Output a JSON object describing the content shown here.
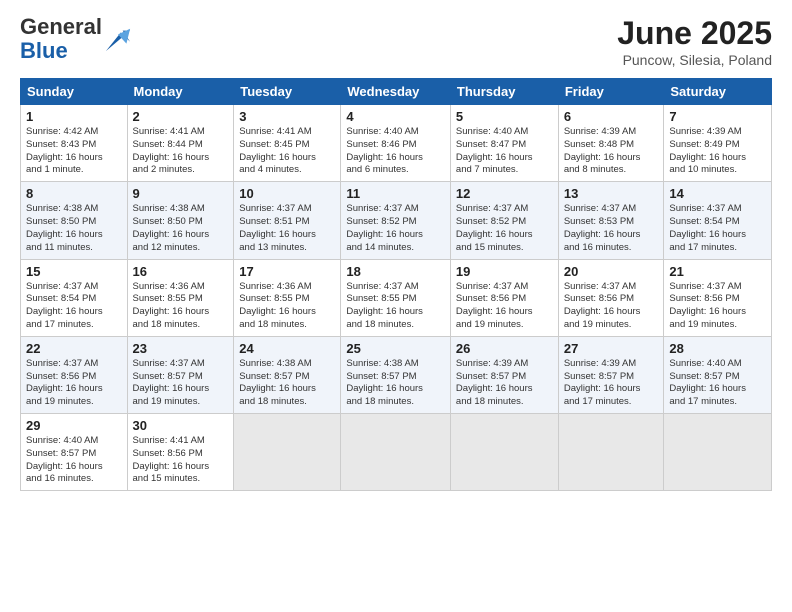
{
  "header": {
    "logo_general": "General",
    "logo_blue": "Blue",
    "month": "June 2025",
    "location": "Puncow, Silesia, Poland"
  },
  "days_of_week": [
    "Sunday",
    "Monday",
    "Tuesday",
    "Wednesday",
    "Thursday",
    "Friday",
    "Saturday"
  ],
  "weeks": [
    [
      {
        "day": 1,
        "info": "Sunrise: 4:42 AM\nSunset: 8:43 PM\nDaylight: 16 hours\nand 1 minute."
      },
      {
        "day": 2,
        "info": "Sunrise: 4:41 AM\nSunset: 8:44 PM\nDaylight: 16 hours\nand 2 minutes."
      },
      {
        "day": 3,
        "info": "Sunrise: 4:41 AM\nSunset: 8:45 PM\nDaylight: 16 hours\nand 4 minutes."
      },
      {
        "day": 4,
        "info": "Sunrise: 4:40 AM\nSunset: 8:46 PM\nDaylight: 16 hours\nand 6 minutes."
      },
      {
        "day": 5,
        "info": "Sunrise: 4:40 AM\nSunset: 8:47 PM\nDaylight: 16 hours\nand 7 minutes."
      },
      {
        "day": 6,
        "info": "Sunrise: 4:39 AM\nSunset: 8:48 PM\nDaylight: 16 hours\nand 8 minutes."
      },
      {
        "day": 7,
        "info": "Sunrise: 4:39 AM\nSunset: 8:49 PM\nDaylight: 16 hours\nand 10 minutes."
      }
    ],
    [
      {
        "day": 8,
        "info": "Sunrise: 4:38 AM\nSunset: 8:50 PM\nDaylight: 16 hours\nand 11 minutes."
      },
      {
        "day": 9,
        "info": "Sunrise: 4:38 AM\nSunset: 8:50 PM\nDaylight: 16 hours\nand 12 minutes."
      },
      {
        "day": 10,
        "info": "Sunrise: 4:37 AM\nSunset: 8:51 PM\nDaylight: 16 hours\nand 13 minutes."
      },
      {
        "day": 11,
        "info": "Sunrise: 4:37 AM\nSunset: 8:52 PM\nDaylight: 16 hours\nand 14 minutes."
      },
      {
        "day": 12,
        "info": "Sunrise: 4:37 AM\nSunset: 8:52 PM\nDaylight: 16 hours\nand 15 minutes."
      },
      {
        "day": 13,
        "info": "Sunrise: 4:37 AM\nSunset: 8:53 PM\nDaylight: 16 hours\nand 16 minutes."
      },
      {
        "day": 14,
        "info": "Sunrise: 4:37 AM\nSunset: 8:54 PM\nDaylight: 16 hours\nand 17 minutes."
      }
    ],
    [
      {
        "day": 15,
        "info": "Sunrise: 4:37 AM\nSunset: 8:54 PM\nDaylight: 16 hours\nand 17 minutes."
      },
      {
        "day": 16,
        "info": "Sunrise: 4:36 AM\nSunset: 8:55 PM\nDaylight: 16 hours\nand 18 minutes."
      },
      {
        "day": 17,
        "info": "Sunrise: 4:36 AM\nSunset: 8:55 PM\nDaylight: 16 hours\nand 18 minutes."
      },
      {
        "day": 18,
        "info": "Sunrise: 4:37 AM\nSunset: 8:55 PM\nDaylight: 16 hours\nand 18 minutes."
      },
      {
        "day": 19,
        "info": "Sunrise: 4:37 AM\nSunset: 8:56 PM\nDaylight: 16 hours\nand 19 minutes."
      },
      {
        "day": 20,
        "info": "Sunrise: 4:37 AM\nSunset: 8:56 PM\nDaylight: 16 hours\nand 19 minutes."
      },
      {
        "day": 21,
        "info": "Sunrise: 4:37 AM\nSunset: 8:56 PM\nDaylight: 16 hours\nand 19 minutes."
      }
    ],
    [
      {
        "day": 22,
        "info": "Sunrise: 4:37 AM\nSunset: 8:56 PM\nDaylight: 16 hours\nand 19 minutes."
      },
      {
        "day": 23,
        "info": "Sunrise: 4:37 AM\nSunset: 8:57 PM\nDaylight: 16 hours\nand 19 minutes."
      },
      {
        "day": 24,
        "info": "Sunrise: 4:38 AM\nSunset: 8:57 PM\nDaylight: 16 hours\nand 18 minutes."
      },
      {
        "day": 25,
        "info": "Sunrise: 4:38 AM\nSunset: 8:57 PM\nDaylight: 16 hours\nand 18 minutes."
      },
      {
        "day": 26,
        "info": "Sunrise: 4:39 AM\nSunset: 8:57 PM\nDaylight: 16 hours\nand 18 minutes."
      },
      {
        "day": 27,
        "info": "Sunrise: 4:39 AM\nSunset: 8:57 PM\nDaylight: 16 hours\nand 17 minutes."
      },
      {
        "day": 28,
        "info": "Sunrise: 4:40 AM\nSunset: 8:57 PM\nDaylight: 16 hours\nand 17 minutes."
      }
    ],
    [
      {
        "day": 29,
        "info": "Sunrise: 4:40 AM\nSunset: 8:57 PM\nDaylight: 16 hours\nand 16 minutes."
      },
      {
        "day": 30,
        "info": "Sunrise: 4:41 AM\nSunset: 8:56 PM\nDaylight: 16 hours\nand 15 minutes."
      },
      null,
      null,
      null,
      null,
      null
    ]
  ]
}
